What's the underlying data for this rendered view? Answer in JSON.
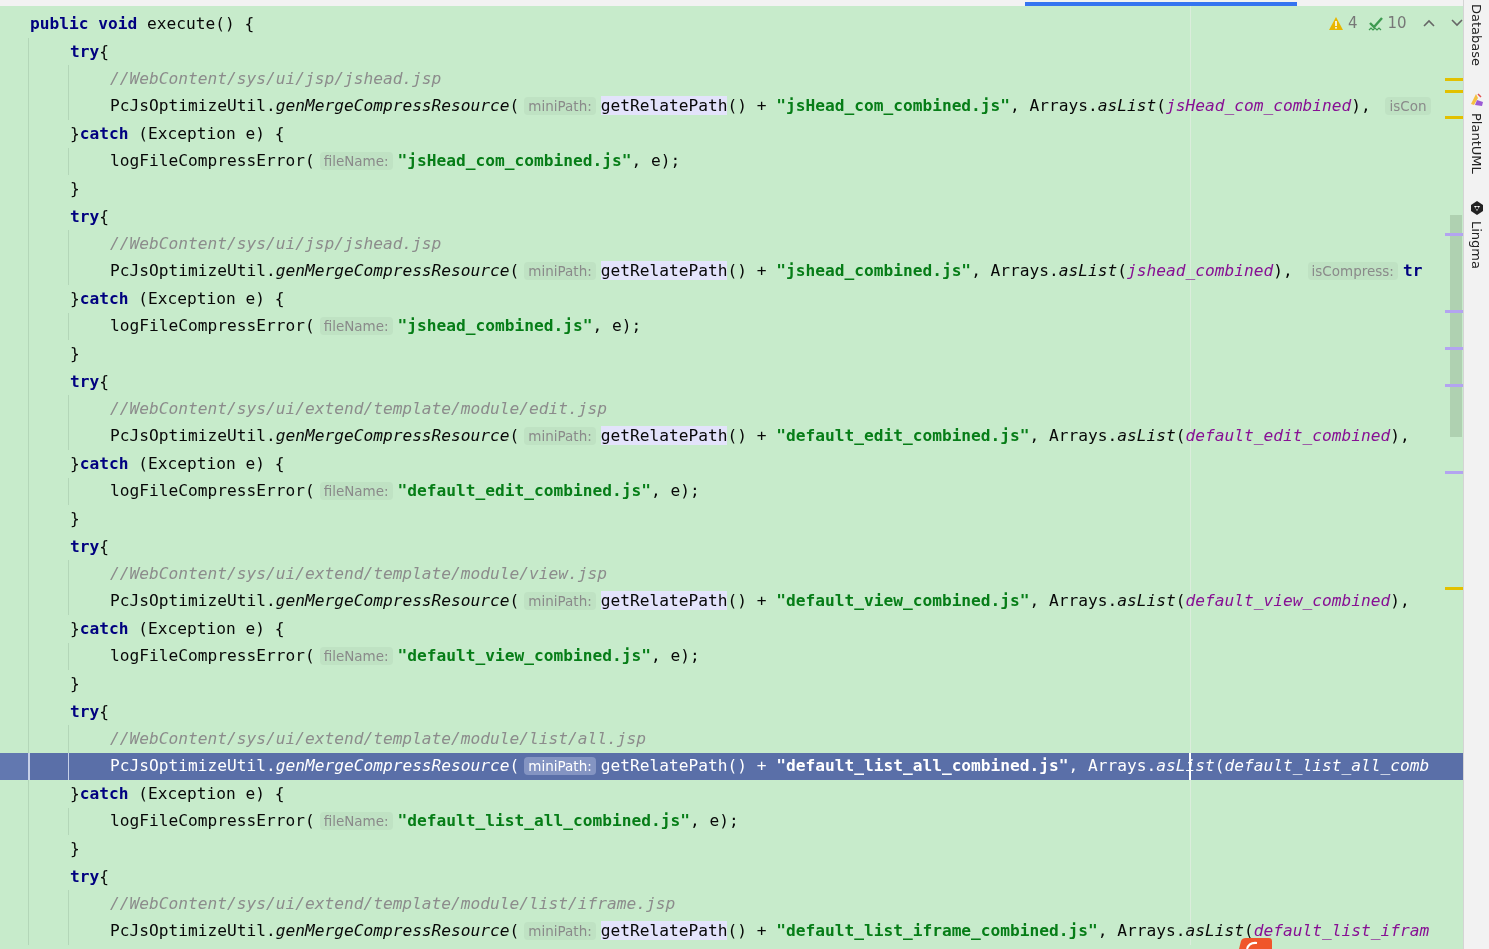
{
  "inspections": {
    "warnings": "4",
    "weak_warnings": "10"
  },
  "tool_windows": [
    {
      "label": "Database"
    },
    {
      "label": "PlantUML"
    },
    {
      "label": "Lingma"
    }
  ],
  "lines": [
    {
      "selected": false,
      "tokens": [
        {
          "kind": "keyword",
          "text": "public void"
        },
        {
          "kind": "plain",
          "text": " execute() {"
        }
      ],
      "children": [
        {
          "selected": false,
          "tokens": [
            {
              "kind": "keyword",
              "text": "try"
            },
            {
              "kind": "plain",
              "text": "{"
            }
          ],
          "children": [
            {
              "selected": false,
              "tokens": [
                {
                  "kind": "comment",
                  "text": "//WebContent/sys/ui/jsp/jshead.jsp"
                }
              ]
            },
            {
              "selected": false,
              "tokens": [
                {
                  "kind": "plain",
                  "text": "PcJsOptimizeUtil."
                },
                {
                  "kind": "static",
                  "text": "genMergeCompressResource"
                },
                {
                  "kind": "plain",
                  "text": "("
                },
                {
                  "kind": "hint",
                  "text": "miniPath:"
                },
                {
                  "kind": "usage",
                  "text": "getRelatePath"
                },
                {
                  "kind": "plain",
                  "text": "() + "
                },
                {
                  "kind": "string",
                  "text": "\"jsHead_com_combined.js\""
                },
                {
                  "kind": "plain",
                  "text": ", Arrays."
                },
                {
                  "kind": "static",
                  "text": "asList"
                },
                {
                  "kind": "plain",
                  "text": "("
                },
                {
                  "kind": "field",
                  "text": "jsHead_com_combined"
                },
                {
                  "kind": "plain",
                  "text": "), "
                },
                {
                  "kind": "hint",
                  "text": "isCon"
                }
              ]
            }
          ]
        },
        {
          "selected": false,
          "tokens": [
            {
              "kind": "plain",
              "text": "}"
            },
            {
              "kind": "keyword",
              "text": "catch"
            },
            {
              "kind": "plain",
              "text": " (Exception e) {"
            }
          ],
          "children": [
            {
              "selected": false,
              "tokens": [
                {
                  "kind": "plain",
                  "text": "logFileCompressError("
                },
                {
                  "kind": "hint",
                  "text": "fileName:"
                },
                {
                  "kind": "string",
                  "text": "\"jsHead_com_combined.js\""
                },
                {
                  "kind": "plain",
                  "text": ", e);"
                }
              ]
            }
          ]
        },
        {
          "selected": false,
          "tokens": [
            {
              "kind": "plain",
              "text": "}"
            }
          ]
        },
        {
          "selected": false,
          "tokens": [
            {
              "kind": "keyword",
              "text": "try"
            },
            {
              "kind": "plain",
              "text": "{"
            }
          ],
          "children": [
            {
              "selected": false,
              "tokens": [
                {
                  "kind": "comment",
                  "text": "//WebContent/sys/ui/jsp/jshead.jsp"
                }
              ]
            },
            {
              "selected": false,
              "tokens": [
                {
                  "kind": "plain",
                  "text": "PcJsOptimizeUtil."
                },
                {
                  "kind": "static",
                  "text": "genMergeCompressResource"
                },
                {
                  "kind": "plain",
                  "text": "("
                },
                {
                  "kind": "hint",
                  "text": "miniPath:"
                },
                {
                  "kind": "usage",
                  "text": "getRelatePath"
                },
                {
                  "kind": "plain",
                  "text": "() + "
                },
                {
                  "kind": "string",
                  "text": "\"jshead_combined.js\""
                },
                {
                  "kind": "plain",
                  "text": ", Arrays."
                },
                {
                  "kind": "static",
                  "text": "asList"
                },
                {
                  "kind": "plain",
                  "text": "("
                },
                {
                  "kind": "field",
                  "text": "jshead_combined"
                },
                {
                  "kind": "plain",
                  "text": "), "
                },
                {
                  "kind": "hint",
                  "text": "isCompress:"
                },
                {
                  "kind": "keyword",
                  "text": "tr"
                }
              ]
            }
          ]
        },
        {
          "selected": false,
          "tokens": [
            {
              "kind": "plain",
              "text": "}"
            },
            {
              "kind": "keyword",
              "text": "catch"
            },
            {
              "kind": "plain",
              "text": " (Exception e) {"
            }
          ],
          "children": [
            {
              "selected": false,
              "tokens": [
                {
                  "kind": "plain",
                  "text": "logFileCompressError("
                },
                {
                  "kind": "hint",
                  "text": "fileName:"
                },
                {
                  "kind": "string",
                  "text": "\"jshead_combined.js\""
                },
                {
                  "kind": "plain",
                  "text": ", e);"
                }
              ]
            }
          ]
        },
        {
          "selected": false,
          "tokens": [
            {
              "kind": "plain",
              "text": "}"
            }
          ]
        },
        {
          "selected": false,
          "tokens": [
            {
              "kind": "keyword",
              "text": "try"
            },
            {
              "kind": "plain",
              "text": "{"
            }
          ],
          "children": [
            {
              "selected": false,
              "tokens": [
                {
                  "kind": "comment",
                  "text": "//WebContent/sys/ui/extend/template/module/edit.jsp"
                }
              ]
            },
            {
              "selected": false,
              "tokens": [
                {
                  "kind": "plain",
                  "text": "PcJsOptimizeUtil."
                },
                {
                  "kind": "static",
                  "text": "genMergeCompressResource"
                },
                {
                  "kind": "plain",
                  "text": "("
                },
                {
                  "kind": "hint",
                  "text": "miniPath:"
                },
                {
                  "kind": "usage",
                  "text": "getRelatePath"
                },
                {
                  "kind": "plain",
                  "text": "() + "
                },
                {
                  "kind": "string",
                  "text": "\"default_edit_combined.js\""
                },
                {
                  "kind": "plain",
                  "text": ", Arrays."
                },
                {
                  "kind": "static",
                  "text": "asList"
                },
                {
                  "kind": "plain",
                  "text": "("
                },
                {
                  "kind": "field",
                  "text": "default_edit_combined"
                },
                {
                  "kind": "plain",
                  "text": "),"
                }
              ]
            }
          ]
        },
        {
          "selected": false,
          "tokens": [
            {
              "kind": "plain",
              "text": "}"
            },
            {
              "kind": "keyword",
              "text": "catch"
            },
            {
              "kind": "plain",
              "text": " (Exception e) {"
            }
          ],
          "children": [
            {
              "selected": false,
              "tokens": [
                {
                  "kind": "plain",
                  "text": "logFileCompressError("
                },
                {
                  "kind": "hint",
                  "text": "fileName:"
                },
                {
                  "kind": "string",
                  "text": "\"default_edit_combined.js\""
                },
                {
                  "kind": "plain",
                  "text": ", e);"
                }
              ]
            }
          ]
        },
        {
          "selected": false,
          "tokens": [
            {
              "kind": "plain",
              "text": "}"
            }
          ]
        },
        {
          "selected": false,
          "tokens": [
            {
              "kind": "keyword",
              "text": "try"
            },
            {
              "kind": "plain",
              "text": "{"
            }
          ],
          "children": [
            {
              "selected": false,
              "tokens": [
                {
                  "kind": "comment",
                  "text": "//WebContent/sys/ui/extend/template/module/view.jsp"
                }
              ]
            },
            {
              "selected": false,
              "tokens": [
                {
                  "kind": "plain",
                  "text": "PcJsOptimizeUtil."
                },
                {
                  "kind": "static",
                  "text": "genMergeCompressResource"
                },
                {
                  "kind": "plain",
                  "text": "("
                },
                {
                  "kind": "hint",
                  "text": "miniPath:"
                },
                {
                  "kind": "usage",
                  "text": "getRelatePath"
                },
                {
                  "kind": "plain",
                  "text": "() + "
                },
                {
                  "kind": "string",
                  "text": "\"default_view_combined.js\""
                },
                {
                  "kind": "plain",
                  "text": ", Arrays."
                },
                {
                  "kind": "static",
                  "text": "asList"
                },
                {
                  "kind": "plain",
                  "text": "("
                },
                {
                  "kind": "field",
                  "text": "default_view_combined"
                },
                {
                  "kind": "plain",
                  "text": "),"
                }
              ]
            }
          ]
        },
        {
          "selected": false,
          "tokens": [
            {
              "kind": "plain",
              "text": "}"
            },
            {
              "kind": "keyword",
              "text": "catch"
            },
            {
              "kind": "plain",
              "text": " (Exception e) {"
            }
          ],
          "children": [
            {
              "selected": false,
              "tokens": [
                {
                  "kind": "plain",
                  "text": "logFileCompressError("
                },
                {
                  "kind": "hint",
                  "text": "fileName:"
                },
                {
                  "kind": "string",
                  "text": "\"default_view_combined.js\""
                },
                {
                  "kind": "plain",
                  "text": ", e);"
                }
              ]
            }
          ]
        },
        {
          "selected": false,
          "tokens": [
            {
              "kind": "plain",
              "text": "}"
            }
          ]
        },
        {
          "selected": false,
          "tokens": [
            {
              "kind": "keyword",
              "text": "try"
            },
            {
              "kind": "plain",
              "text": "{"
            }
          ],
          "children": [
            {
              "selected": false,
              "tokens": [
                {
                  "kind": "comment",
                  "text": "//WebContent/sys/ui/extend/template/module/list/all.jsp"
                }
              ]
            },
            {
              "selected": true,
              "tokens": [
                {
                  "kind": "plain",
                  "text": "PcJsOptimizeUtil."
                },
                {
                  "kind": "static",
                  "text": "genMergeCompressResource"
                },
                {
                  "kind": "plain",
                  "text": "("
                },
                {
                  "kind": "hint",
                  "text": "miniPath:"
                },
                {
                  "kind": "plain",
                  "text": "getRelatePath() + "
                },
                {
                  "kind": "string",
                  "text": "\"default_list_all_combined.js\""
                },
                {
                  "kind": "plain",
                  "text": ", Arrays."
                },
                {
                  "kind": "static",
                  "text": "asList"
                },
                {
                  "kind": "plain",
                  "text": "("
                },
                {
                  "kind": "field",
                  "text": "default_list_all_comb"
                }
              ]
            }
          ]
        },
        {
          "selected": false,
          "tokens": [
            {
              "kind": "plain",
              "text": "}"
            },
            {
              "kind": "keyword",
              "text": "catch"
            },
            {
              "kind": "plain",
              "text": " (Exception e) {"
            }
          ],
          "children": [
            {
              "selected": false,
              "tokens": [
                {
                  "kind": "plain",
                  "text": "logFileCompressError("
                },
                {
                  "kind": "hint",
                  "text": "fileName:"
                },
                {
                  "kind": "string",
                  "text": "\"default_list_all_combined.js\""
                },
                {
                  "kind": "plain",
                  "text": ", e);"
                }
              ]
            }
          ]
        },
        {
          "selected": false,
          "tokens": [
            {
              "kind": "plain",
              "text": "}"
            }
          ]
        },
        {
          "selected": false,
          "tokens": [
            {
              "kind": "keyword",
              "text": "try"
            },
            {
              "kind": "plain",
              "text": "{"
            }
          ],
          "children": [
            {
              "selected": false,
              "tokens": [
                {
                  "kind": "comment",
                  "text": "//WebContent/sys/ui/extend/template/module/list/iframe.jsp"
                }
              ]
            },
            {
              "selected": false,
              "tokens": [
                {
                  "kind": "plain",
                  "text": "PcJsOptimizeUtil."
                },
                {
                  "kind": "static",
                  "text": "genMergeCompressResource"
                },
                {
                  "kind": "plain",
                  "text": "("
                },
                {
                  "kind": "hint",
                  "text": "miniPath:"
                },
                {
                  "kind": "usage",
                  "text": "getRelatePath"
                },
                {
                  "kind": "plain",
                  "text": "() + "
                },
                {
                  "kind": "string",
                  "text": "\"default_list_iframe_combined.js\""
                },
                {
                  "kind": "plain",
                  "text": ", Arrays."
                },
                {
                  "kind": "static",
                  "text": "asList"
                },
                {
                  "kind": "plain",
                  "text": "("
                },
                {
                  "kind": "field",
                  "text": "default_list_ifram"
                }
              ]
            }
          ]
        }
      ]
    }
  ]
}
